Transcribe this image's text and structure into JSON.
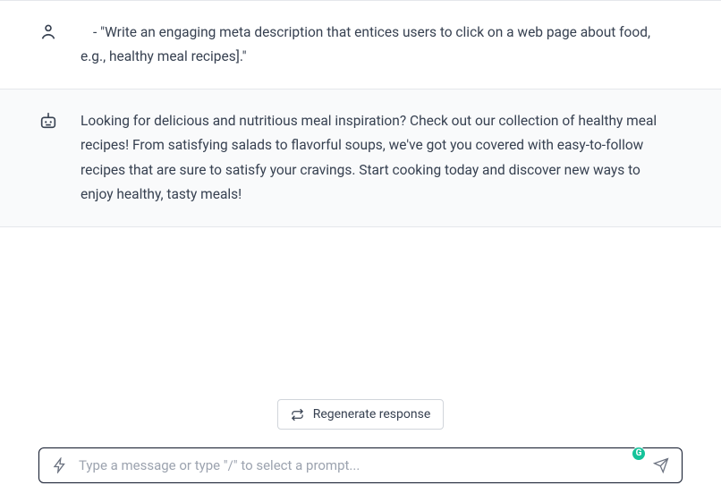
{
  "messages": {
    "user": {
      "text": "- \"Write an engaging meta description that entices users to click on a web page about food, e.g., healthy meal recipes].\""
    },
    "assistant": {
      "text": "Looking for delicious and nutritious meal inspiration? Check out our collection of healthy meal recipes! From satisfying salads to flavorful soups, we've got you covered with easy-to-follow recipes that are sure to satisfy your cravings. Start cooking today and discover new ways to enjoy healthy, tasty meals!"
    }
  },
  "controls": {
    "regenerate_label": "Regenerate response",
    "input_placeholder": "Type a message or type \"/\" to select a prompt...",
    "grammarly_letter": "G"
  }
}
